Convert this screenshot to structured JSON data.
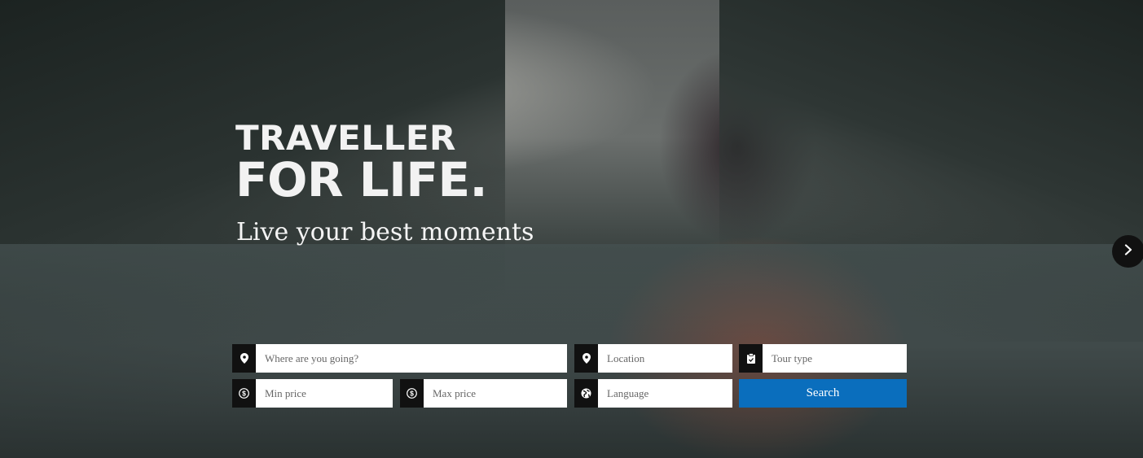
{
  "hero": {
    "headline_line1": "TRAVELLER",
    "headline_line2": "FOR LIFE.",
    "subheadline": "Live your best moments"
  },
  "search_form": {
    "destination": {
      "placeholder": "Where are you going?",
      "icon": "map-pin-icon"
    },
    "location": {
      "placeholder": "Location",
      "icon": "map-pin-icon"
    },
    "tour_type": {
      "placeholder": "Tour type",
      "icon": "clipboard-check-icon"
    },
    "min_price": {
      "placeholder": "Min price",
      "icon": "dollar-coin-icon"
    },
    "max_price": {
      "placeholder": "Max price",
      "icon": "dollar-coin-icon"
    },
    "language": {
      "placeholder": "Language",
      "icon": "globe-icon"
    },
    "search_label": "Search",
    "accent_color": "#0a6ebd"
  },
  "slider": {
    "next_icon": "chevron-right-icon"
  }
}
